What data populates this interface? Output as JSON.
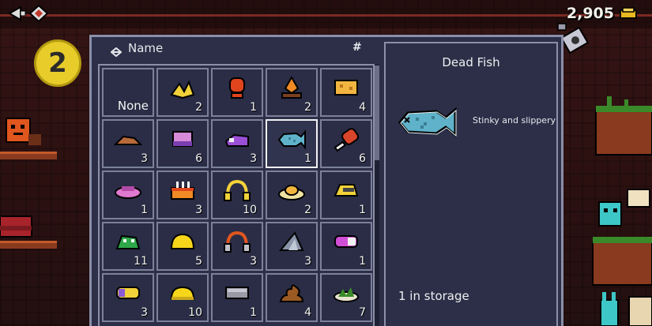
{
  "hud": {
    "coins": "2,905",
    "coin_icon": "gold-bar-icon",
    "level": "2"
  },
  "inventory": {
    "sort_label": "Name",
    "count_header": "#",
    "none_label": "None",
    "rows": [
      [
        {
          "name": "none",
          "count": ""
        },
        {
          "name": "banana-peel-icon",
          "count": "2"
        },
        {
          "name": "red-orb-icon",
          "count": "1"
        },
        {
          "name": "campfire-icon",
          "count": "2"
        },
        {
          "name": "cheese-block-icon",
          "count": "4"
        }
      ],
      [
        {
          "name": "mushroom-hat-icon",
          "count": "3"
        },
        {
          "name": "pink-cake-icon",
          "count": "6"
        },
        {
          "name": "purple-slug-icon",
          "count": "3"
        },
        {
          "name": "dead-fish-icon",
          "count": "1"
        },
        {
          "name": "meat-leg-icon",
          "count": "6"
        }
      ],
      [
        {
          "name": "pink-dish-icon",
          "count": "1"
        },
        {
          "name": "birthday-cake-icon",
          "count": "3"
        },
        {
          "name": "headphones-icon",
          "count": "10"
        },
        {
          "name": "egg-plate-icon",
          "count": "2"
        },
        {
          "name": "helmet-icon",
          "count": "1"
        }
      ],
      [
        {
          "name": "green-frog-icon",
          "count": "11"
        },
        {
          "name": "yellow-dome-icon",
          "count": "5"
        },
        {
          "name": "orange-headphones-icon",
          "count": "3"
        },
        {
          "name": "shark-fin-icon",
          "count": "3"
        },
        {
          "name": "purple-can-icon",
          "count": "1"
        }
      ],
      [
        {
          "name": "yellow-can-icon",
          "count": "3"
        },
        {
          "name": "yellow-bun-icon",
          "count": "10"
        },
        {
          "name": "grey-brick-icon",
          "count": "1"
        },
        {
          "name": "brown-poop-icon",
          "count": "4"
        },
        {
          "name": "grass-tuft-icon",
          "count": "7"
        }
      ]
    ]
  },
  "detail": {
    "name": "Dead Fish",
    "description": "Stinky and slippery",
    "storage": "1 in storage",
    "icon": "dead-fish-icon"
  },
  "colors": {
    "panel": "#2c2f47",
    "border": "#8b8fa8",
    "level_badge": "#e8cc2a"
  }
}
